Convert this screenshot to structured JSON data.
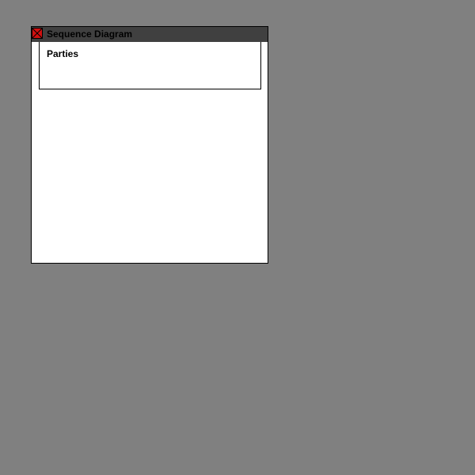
{
  "window": {
    "title": "Sequence Diagram",
    "close_icon": "close-icon"
  },
  "diagram": {
    "parties_label": "Parties"
  },
  "colors": {
    "desktop": "#808080",
    "titlebar": "#404040",
    "close_box": "#d01010",
    "window_bg": "#ffffff",
    "border": "#000000"
  }
}
